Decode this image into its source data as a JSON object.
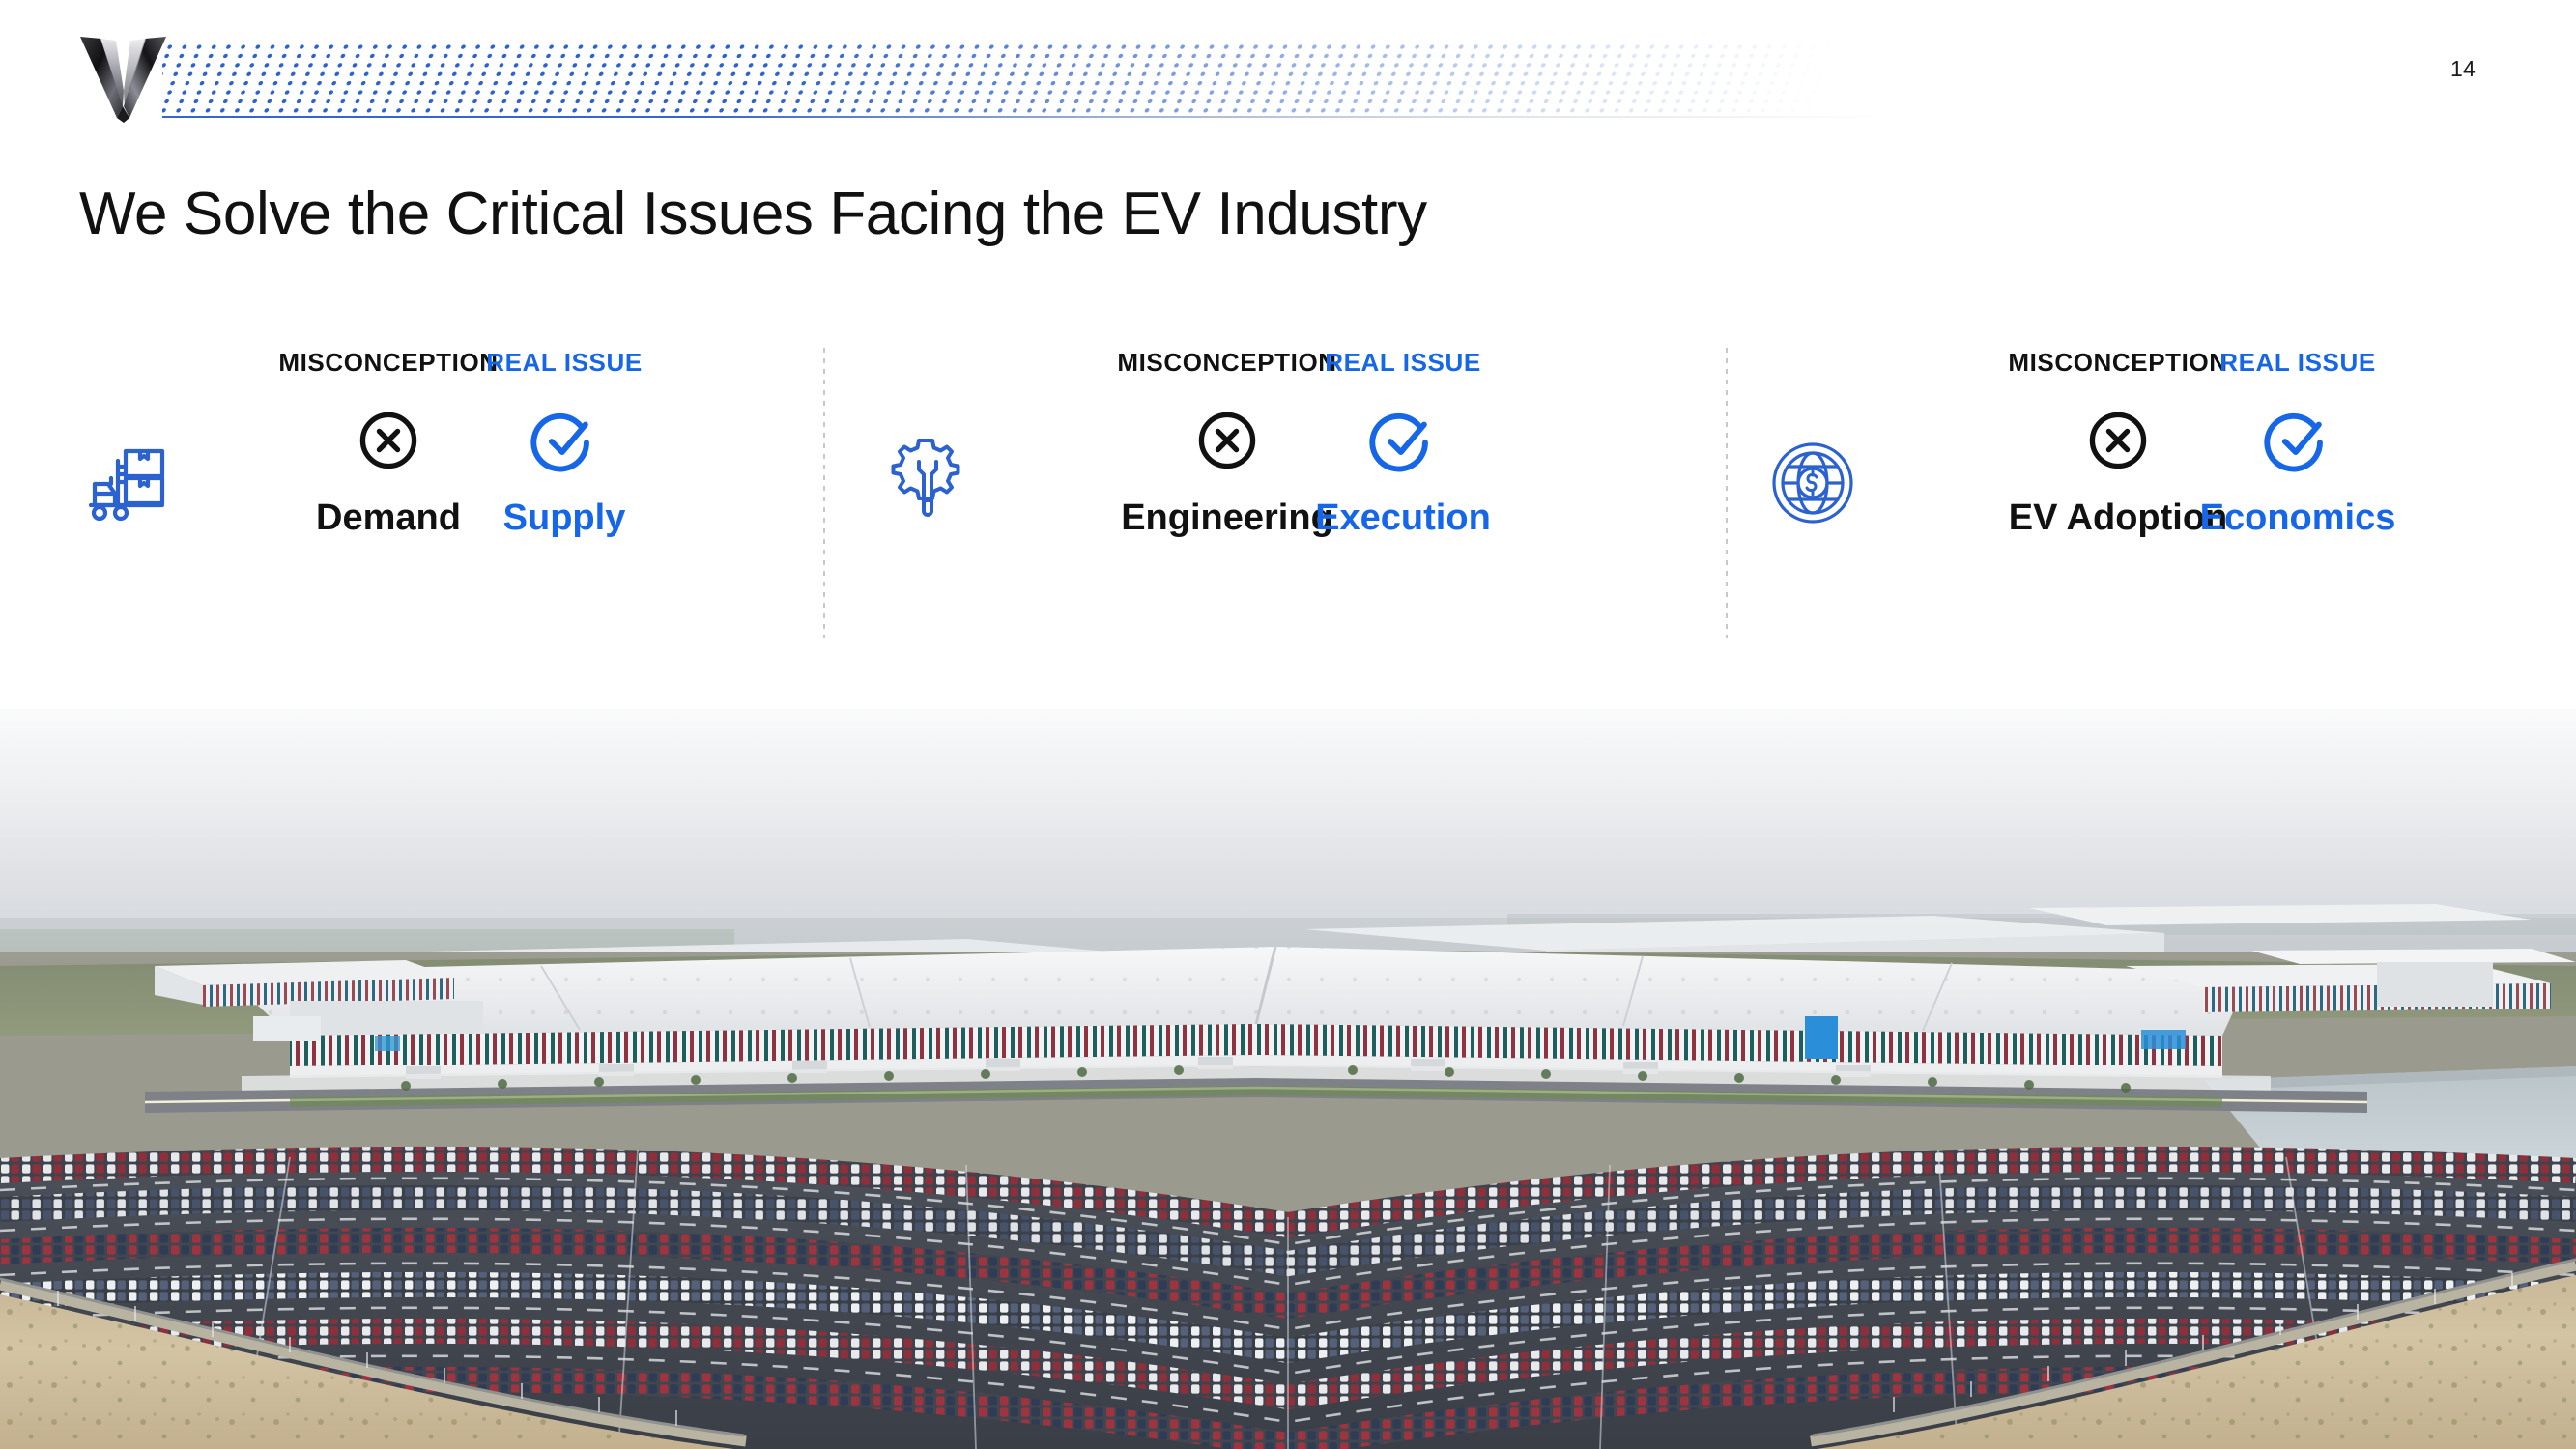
{
  "header": {
    "logo_icon": "vinfast-v-chevron-logo",
    "page_number": "14",
    "decor": "halftone-dot-band"
  },
  "title": "We Solve the Critical Issues Facing the EV Industry",
  "colors": {
    "accent_blue": "#1667E8",
    "icon_blue": "#2b62cf",
    "text_dark": "#111111",
    "divider_gray": "#c8c8cc"
  },
  "comparison": {
    "kicker_misconception": "MISCONCEPTION",
    "kicker_real_issue": "REAL ISSUE",
    "groups": [
      {
        "icon": "forklift-boxes-icon",
        "misconception": "Demand",
        "real_issue": "Supply",
        "misconception_symbol": "x-circle-icon",
        "real_issue_symbol": "check-circle-icon"
      },
      {
        "icon": "gear-wrench-icon",
        "misconception": "Engineering",
        "real_issue": "Execution",
        "misconception_symbol": "x-circle-icon",
        "real_issue_symbol": "check-circle-icon"
      },
      {
        "icon": "globe-dollar-icon",
        "misconception": "EV Adoption",
        "real_issue": "Economics",
        "misconception_symbol": "x-circle-icon",
        "real_issue_symbol": "check-circle-icon"
      }
    ]
  },
  "photo": {
    "alt": "Aerial view of an EV manufacturing plant with large white factory buildings with red and teal striped facades, surrounded by curved parking lots filled with thousands of new vehicles, a water reservoir on the right and sandy open land in the foreground"
  }
}
